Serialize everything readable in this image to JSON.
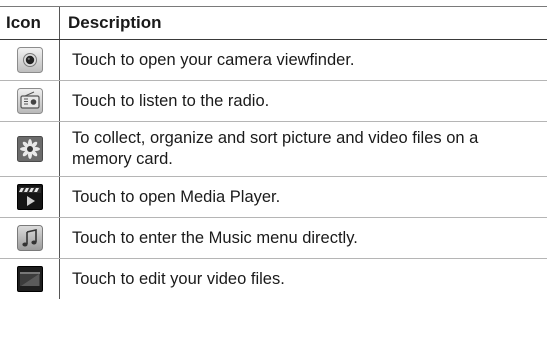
{
  "table": {
    "headers": {
      "icon": "Icon",
      "description": "Description"
    },
    "rows": [
      {
        "icon": "camera-icon",
        "description": "Touch to open your camera viewfinder."
      },
      {
        "icon": "radio-icon",
        "description": "Touch to listen to the radio."
      },
      {
        "icon": "gallery-flower-icon",
        "description": "To collect, organize and sort picture and video files on a memory card."
      },
      {
        "icon": "media-player-icon",
        "description": "Touch to open Media Player."
      },
      {
        "icon": "music-note-icon",
        "description": "Touch to enter the Music menu directly."
      },
      {
        "icon": "video-edit-icon",
        "description": "Touch to edit your video files."
      }
    ]
  }
}
